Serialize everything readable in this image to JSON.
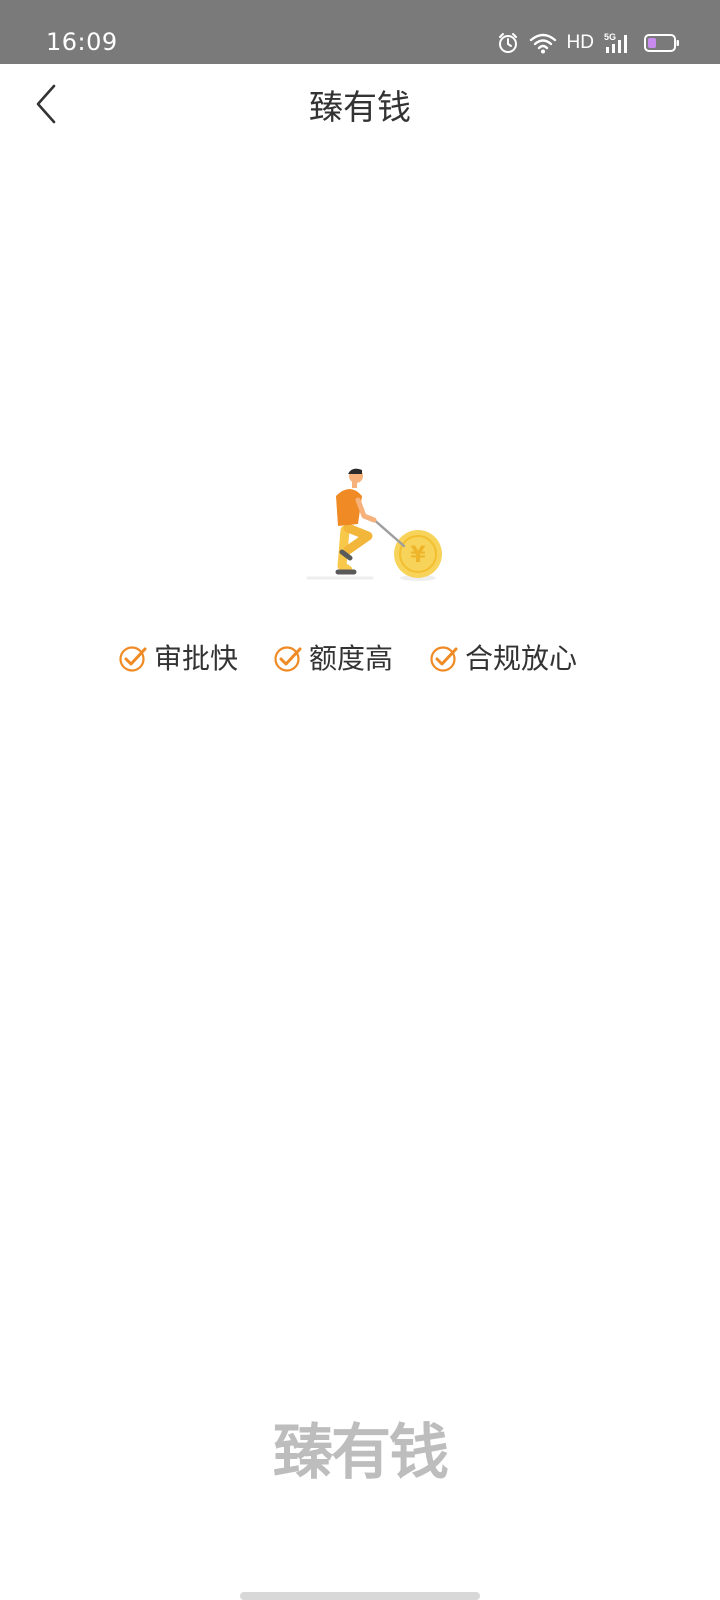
{
  "status_bar": {
    "time": "16:09",
    "network_label": "HD",
    "signal_label": "5G",
    "icons": [
      "alarm-icon",
      "wifi-icon",
      "signal-icon",
      "battery-icon"
    ]
  },
  "nav": {
    "title": "臻有钱",
    "back_icon": "chevron-left-icon"
  },
  "illustration": {
    "description_icon": "person-pushing-coin-illustration",
    "coin_symbol": "¥"
  },
  "features": [
    {
      "label": "审批快",
      "icon": "check-circle-icon"
    },
    {
      "label": "额度高",
      "icon": "check-circle-icon"
    },
    {
      "label": "合规放心",
      "icon": "check-circle-icon"
    }
  ],
  "footer": {
    "logo_text": "臻有钱"
  },
  "colors": {
    "status_bar_bg": "#7a7a7a",
    "accent_orange": "#f08a24",
    "coin_yellow": "#f7d35a",
    "text_dark": "#333333",
    "logo_gray": "#bdbdbd"
  }
}
